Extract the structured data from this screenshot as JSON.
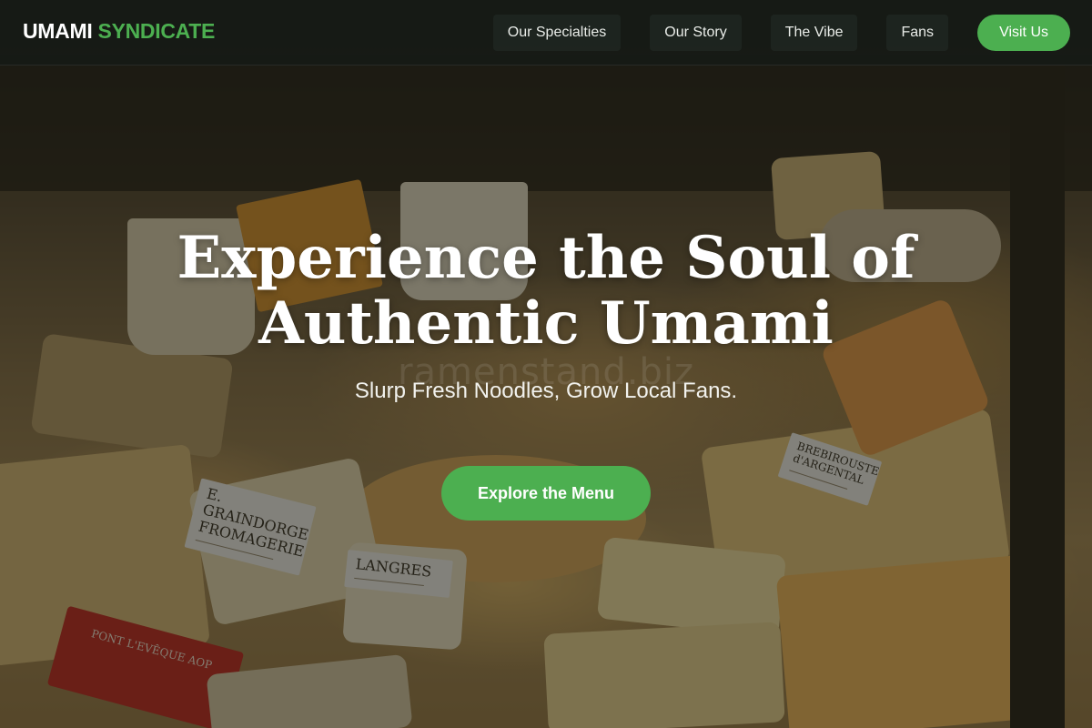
{
  "header": {
    "logo_primary": "UMAMI",
    "logo_accent": "SYNDICATE",
    "nav": [
      {
        "label": "Our Specialties"
      },
      {
        "label": "Our Story"
      },
      {
        "label": "The Vibe"
      },
      {
        "label": "Fans"
      }
    ],
    "cta_label": "Visit Us"
  },
  "hero": {
    "title": "Experience the Soul of Authentic Umami",
    "watermark": "ramenstand.biz",
    "subtitle": "Slurp Fresh Noodles, Grow Local Fans.",
    "cta_label": "Explore the Menu",
    "image_tags": [
      {
        "text": "E. GRAINDORGE FROMAGERIE"
      },
      {
        "text": "LANGRES"
      },
      {
        "text": "BREBIROUSTE d'ARGENTAL"
      },
      {
        "text": "PONT L'EVÊQUE AOP"
      }
    ]
  },
  "colors": {
    "accent": "#4caf50",
    "header_bg": "#161a16",
    "text_light": "#ffffff"
  }
}
